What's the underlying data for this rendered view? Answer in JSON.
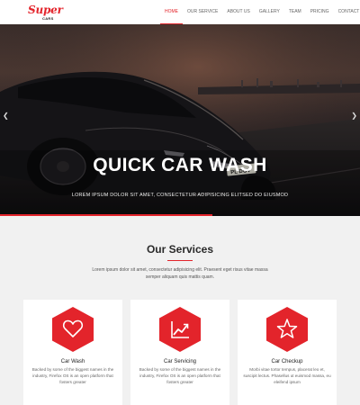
{
  "brand": {
    "logo_main": "Super",
    "logo_sub": "CARS",
    "accent_color": "#e3242b"
  },
  "nav": {
    "items": [
      {
        "label": "HOME",
        "active": true
      },
      {
        "label": "OUR SERVICE",
        "active": false
      },
      {
        "label": "ABOUT US",
        "active": false
      },
      {
        "label": "GALLERY",
        "active": false
      },
      {
        "label": "TEAM",
        "active": false
      },
      {
        "label": "PRICING",
        "active": false
      },
      {
        "label": "CONTACT",
        "active": false
      }
    ]
  },
  "hero": {
    "title": "QUICK CAR WASH",
    "subtitle": "LOREM IPSUM DOLOR SIT AMET, CONSECTETUR ADIPISICING ELITSED DO EIUSMOD",
    "plate": "PL DOV",
    "prev_icon": "chevron-left-icon",
    "next_icon": "chevron-right-icon"
  },
  "services": {
    "title": "Our Services",
    "description": "Lorem ipsum dolor sit amet, consectetur adipisicing elit. Praesent eget risus vitae massa semper aliquam quis mattis quam.",
    "cards": [
      {
        "icon": "heart-icon",
        "title": "Car Wash",
        "text": "Backed by some of the biggest names in the industry, Firefox OS is an open platform that fosters greater"
      },
      {
        "icon": "chart-line-icon",
        "title": "Car Servicing",
        "text": "Backed by some of the biggest names in the industry, Firefox OS is an open platform that fosters greater"
      },
      {
        "icon": "star-icon",
        "title": "Car Checkup",
        "text": "Morbi vitae tortor tempus, placerat leo et, suscipit lectus. Phasellus ut euismod massa, eu eleifend ipsum"
      }
    ]
  }
}
